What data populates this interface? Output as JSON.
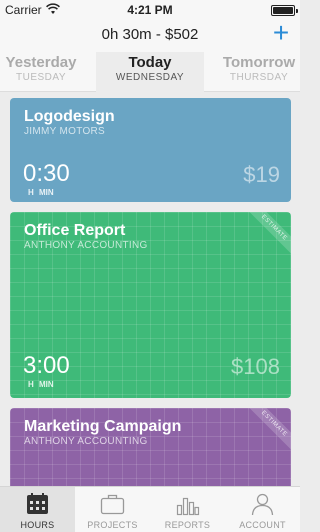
{
  "status_bar": {
    "carrier": "Carrier",
    "time": "4:21 PM"
  },
  "header": {
    "summary": "0h 30m - $502",
    "add_label": "+",
    "days": [
      {
        "name": "Yesterday",
        "weekday": "TUESDAY"
      },
      {
        "name": "Today",
        "weekday": "WEDNESDAY"
      },
      {
        "name": "Tomorrow",
        "weekday": "THURSDAY"
      }
    ]
  },
  "cards": [
    {
      "title": "Logodesign",
      "client": "JIMMY MOTORS",
      "duration": "0:30",
      "unit_h": "H",
      "unit_min": "MIN",
      "amount": "$19",
      "color": "#6aa5c4",
      "estimate": ""
    },
    {
      "title": "Office Report",
      "client": "ANTHONY ACCOUNTING",
      "duration": "3:00",
      "unit_h": "H",
      "unit_min": "MIN",
      "amount": "$108",
      "color": "#3fba79",
      "estimate": "ESTIMATE"
    },
    {
      "title": "Marketing Campaign",
      "client": "ANTHONY ACCOUNTING",
      "estimate": "ESTIMATE",
      "color": "#8e63a6"
    }
  ],
  "tabs": [
    {
      "label": "HOURS",
      "icon": "calendar-icon",
      "active": true
    },
    {
      "label": "PROJECTS",
      "icon": "briefcase-icon",
      "active": false
    },
    {
      "label": "REPORTS",
      "icon": "bar-chart-icon",
      "active": false
    },
    {
      "label": "ACCOUNT",
      "icon": "person-icon",
      "active": false
    }
  ]
}
